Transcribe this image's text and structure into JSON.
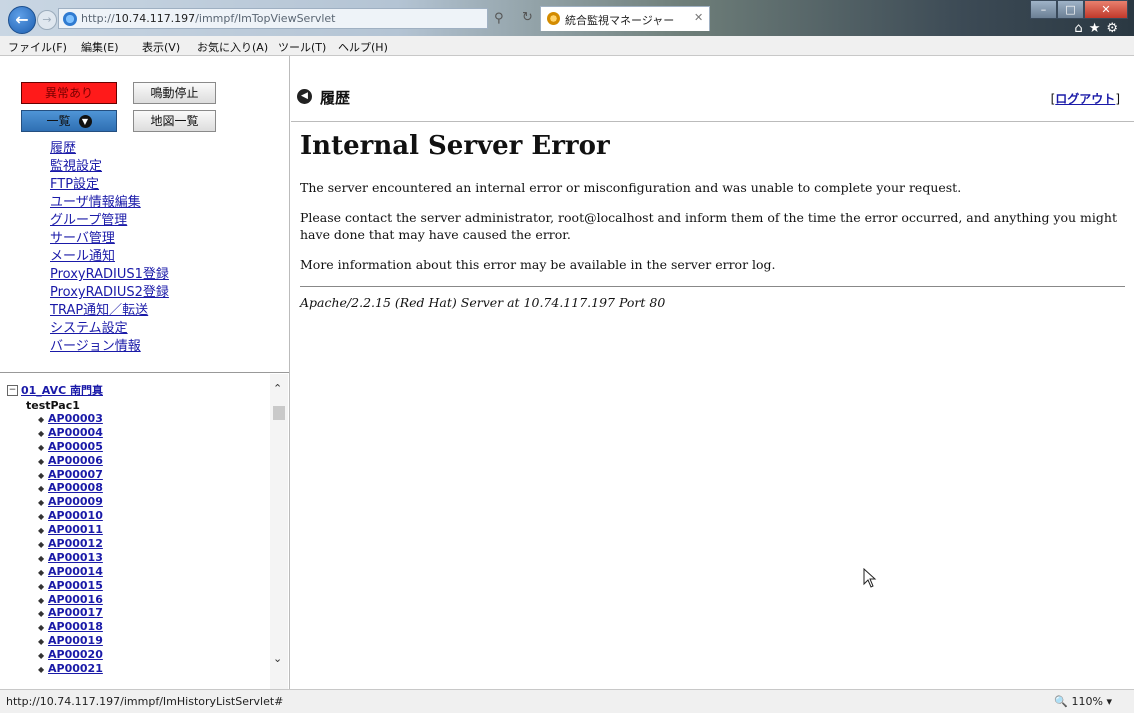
{
  "browser": {
    "url_prefix": "http://",
    "url_host": "10.74.117.197",
    "url_path": "/immpf/ImTopViewServlet",
    "tab_title": "統合監視マネージャー",
    "menu": [
      "ファイル(F)",
      "編集(E)",
      "表示(V)",
      "お気に入り(A)",
      "ツール(T)",
      "ヘルプ(H)"
    ],
    "status_url": "http://10.74.117.197/immpf/ImHistoryListServlet#",
    "zoom": "110%"
  },
  "sidebar": {
    "alarm_button": "異常あり",
    "stop_button": "鳴動停止",
    "list_button": "一覧",
    "map_button": "地図一覧",
    "links": [
      "履歴",
      "監視設定",
      "FTP設定",
      "ユーザ情報編集",
      "グループ管理",
      "サーバ管理",
      "メール通知",
      "ProxyRADIUS1登録",
      "ProxyRADIUS2登録",
      "TRAP通知／転送",
      "システム設定",
      "バージョン情報"
    ],
    "tree": {
      "root": "01_AVC 南門真",
      "group": "testPac1",
      "items": [
        "AP00003",
        "AP00004",
        "AP00005",
        "AP00006",
        "AP00007",
        "AP00008",
        "AP00009",
        "AP00010",
        "AP00011",
        "AP00012",
        "AP00013",
        "AP00014",
        "AP00015",
        "AP00016",
        "AP00017",
        "AP00018",
        "AP00019",
        "AP00020",
        "AP00021"
      ]
    }
  },
  "main": {
    "title": "履歴",
    "logout_open": "[",
    "logout_label": "ログアウト",
    "logout_close": "]",
    "error": {
      "heading": "Internal Server Error",
      "p1": "The server encountered an internal error or misconfiguration and was unable to complete your request.",
      "p2": "Please contact the server administrator, root@localhost and inform them of the time the error occurred, and anything you might have done that may have caused the error.",
      "p3": "More information about this error may be available in the server error log.",
      "address": "Apache/2.2.15 (Red Hat) Server at 10.74.117.197 Port 80"
    }
  }
}
